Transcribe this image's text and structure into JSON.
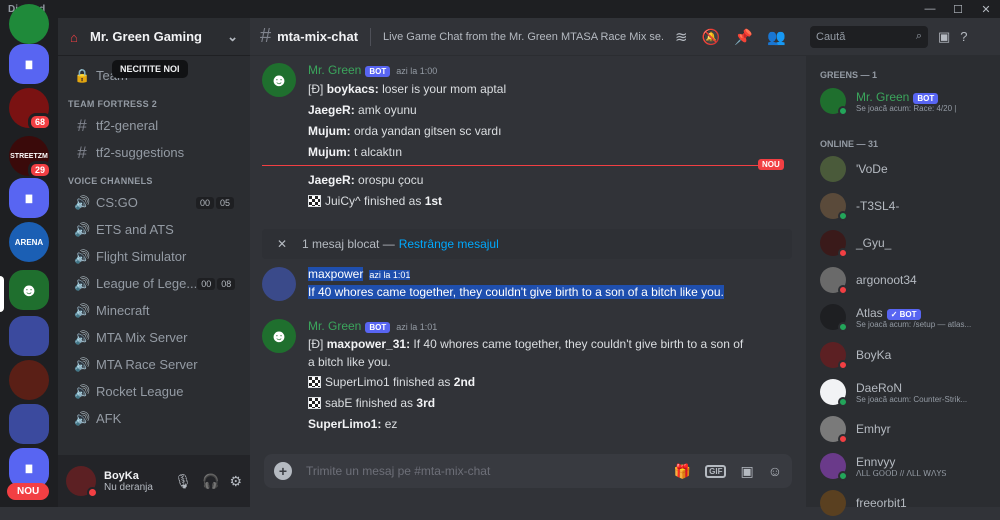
{
  "window": {
    "app_title": "Discord",
    "minimize": "—",
    "maximize": "☐",
    "close": "✕"
  },
  "servers": {
    "badges": [
      "68",
      "29"
    ],
    "new_label": "NOU",
    "streetz_label": "STREETZM",
    "arena_label": "ARENA"
  },
  "guild": {
    "name": "Mr. Green Gaming",
    "tooltip": "NECITITE NOI",
    "team_channel": "Team",
    "categories": {
      "tf2": "TEAM FORTRESS 2",
      "voice": "VOICE CHANNELS"
    },
    "text_channels": [
      "tf2-general",
      "tf2-suggestions"
    ],
    "voice_channels": [
      {
        "name": "CS:GO",
        "count": "00",
        "limit": "05"
      },
      {
        "name": "ETS and ATS"
      },
      {
        "name": "Flight Simulator"
      },
      {
        "name": "League of Lege...",
        "count": "00",
        "limit": "08"
      },
      {
        "name": "Minecraft"
      },
      {
        "name": "MTA Mix Server"
      },
      {
        "name": "MTA Race Server"
      },
      {
        "name": "Rocket League"
      },
      {
        "name": "AFK"
      }
    ]
  },
  "user": {
    "name": "BoyKa",
    "status": "Nu deranja"
  },
  "channel": {
    "name": "mta-mix-chat",
    "topic": "Live Game Chat from the Mr. Green MTASA Race Mix se..."
  },
  "messages": {
    "m1": {
      "author": "Mr. Green",
      "bot": "BOT",
      "time": "azi la 1:00",
      "l1_prefix": "[Ð]",
      "l1_name": "boykacs:",
      "l1_text": "loser is your mom aptal",
      "l2_name": "JaegeR:",
      "l2_text": "amk oyunu",
      "l3_name": "Mujum:",
      "l3_text": "orda yandan gitsen sc vardı",
      "l4_name": "Mujum:",
      "l4_text": "t alcaktın",
      "l5_name": "JaegeR:",
      "l5_text": "orospu çocu",
      "l6_text": "JuiCy^ finished as",
      "l6_rank": "1st"
    },
    "new_tag": "NOU",
    "blocked": {
      "text": "1 mesaj blocat —",
      "link": "Restrânge mesajul"
    },
    "m2": {
      "author": "maxpower",
      "time": "azi la 1:01",
      "text": "If 40 whores came together, they couldn't give birth to a son of a bitch like you."
    },
    "m3": {
      "author": "Mr. Green",
      "bot": "BOT",
      "time": "azi la 1:01",
      "l1_prefix": "[Ð]",
      "l1_name": "maxpower_31:",
      "l1_text": "If 40 whores came together, they couldn't give birth to a son of",
      "l1b": "a bitch like you.",
      "l2_text": "SuperLimo1 finished as",
      "l2_rank": "2nd",
      "l3_text": "sabE finished as",
      "l3_rank": "3rd",
      "l4_name": "SuperLimo1:",
      "l4_text": "ez"
    }
  },
  "composer": {
    "placeholder": "Trimite un mesaj pe #mta-mix-chat",
    "gif": "GIF"
  },
  "search": {
    "placeholder": "Caută"
  },
  "members": {
    "greens_header": "GREENS — 1",
    "online_header": "ONLINE — 31",
    "greens": [
      {
        "name": "Mr. Green",
        "bot": "BOT",
        "activity": "Se joacă acum: Race: 4/20 |"
      }
    ],
    "online": [
      {
        "name": "'VoDe",
        "activity": ""
      },
      {
        "name": "-T3SL4-",
        "activity": ""
      },
      {
        "name": "_Gyu_",
        "activity": ""
      },
      {
        "name": "argonoot34",
        "activity": ""
      },
      {
        "name": "Atlas",
        "bot": "BOT",
        "activity": "Se joacă acum: /setup — atlas..."
      },
      {
        "name": "BoyKa",
        "activity": ""
      },
      {
        "name": "DaeRoN",
        "activity": "Se joacă acum: Counter-Strik..."
      },
      {
        "name": "Emhyr",
        "activity": ""
      },
      {
        "name": "Ennvyy",
        "activity": "ꓥꓡꓡ ꓖꓳꓳꓓ // ꓥꓡꓡ ꓪꓥꓬꓢ"
      },
      {
        "name": "freeorbit1",
        "activity": ""
      }
    ]
  },
  "colors": {
    "accent": "#5865f2",
    "green_name": "#3ba55c",
    "danger": "#f23f43",
    "link": "#00a8fc",
    "highlight": "#1f4fae"
  }
}
